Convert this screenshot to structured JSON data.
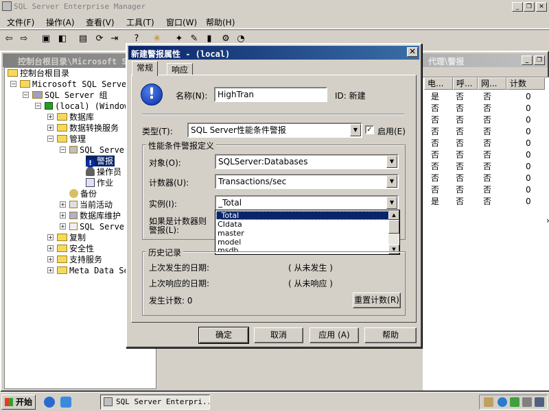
{
  "window": {
    "title": "SQL Server Enterprise Manager"
  },
  "menu": [
    "文件(F)",
    "操作(A)",
    "查看(V)",
    "工具(T)",
    "窗口(W)",
    "帮助(H)"
  ],
  "child": {
    "title_left": "控制台根目录\\Microsoft S",
    "title_right": "代理\\警报"
  },
  "tree": {
    "root": "控制台根目录",
    "servers": "Microsoft SQL Servers",
    "group": "SQL Server 组",
    "local": "(local) (Windows",
    "databases": "数据库",
    "dts": "数据转换服务",
    "management": "管理",
    "agent": "SQL Server",
    "alerts": "警报",
    "operators": "操作员",
    "jobs": "作业",
    "backup": "备份",
    "activity": "当前活动",
    "maint": "数据库维护",
    "logs": "SQL Server",
    "replication": "复制",
    "security": "安全性",
    "support": "支持服务",
    "meta": "Meta Data Ser"
  },
  "list": {
    "headers": [
      "电...",
      "呼...",
      "网...",
      "计数"
    ],
    "rows": [
      [
        "是",
        "否",
        "否",
        "0"
      ],
      [
        "否",
        "否",
        "否",
        "0"
      ],
      [
        "否",
        "否",
        "否",
        "0"
      ],
      [
        "否",
        "否",
        "否",
        "0"
      ],
      [
        "否",
        "否",
        "否",
        "0"
      ],
      [
        "否",
        "否",
        "否",
        "0"
      ],
      [
        "否",
        "否",
        "否",
        "0"
      ],
      [
        "否",
        "否",
        "否",
        "0"
      ],
      [
        "否",
        "否",
        "否",
        "0"
      ],
      [
        "是",
        "否",
        "否",
        "0"
      ]
    ]
  },
  "dialog": {
    "title": "新建警报属性 - (local)",
    "tabs": [
      "常规",
      "响应"
    ],
    "name_label": "名称(N):",
    "name_value": "HighTran",
    "id_label": "ID: 新建",
    "type_label": "类型(T):",
    "type_value": "SQL Server性能条件警报",
    "enabled_label": "启用(E)",
    "perf_group": "性能条件警报定义",
    "object_label": "对象(O):",
    "object_value": "SQLServer:Databases",
    "counter_label": "计数器(U):",
    "counter_value": "Transactions/sec",
    "instance_label": "实例(I):",
    "instance_value": "_Total",
    "alert_if_1": "如果是计数器则",
    "alert_if_2": "警报(L):",
    "dropdown_items": [
      "_Total",
      "CIdata",
      "master",
      "model",
      "msdb"
    ],
    "history_group": "历史记录",
    "last_occurred_label": "上次发生的日期:",
    "last_occurred_value": "( 从未发生 )",
    "last_responded_label": "上次响应的日期:",
    "last_responded_value": "( 从未响应 )",
    "count_label": "发生计数: 0",
    "reset_button": "重置计数(R)",
    "ok": "确定",
    "cancel": "取消",
    "apply": "应用 (A)",
    "help": "帮助"
  },
  "taskbar": {
    "start": "开始",
    "task": "SQL Server Enterpri..."
  }
}
